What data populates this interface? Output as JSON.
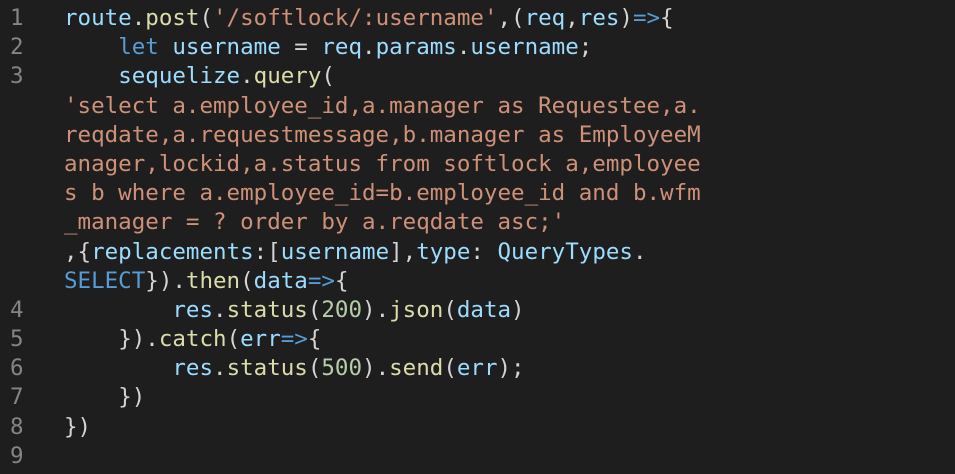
{
  "editor": {
    "colors": {
      "background": "#1e1e1e",
      "line_number": "#858585",
      "plain": "#d4d4d4",
      "function": "#dcdcaa",
      "variable": "#9cdcfe",
      "keyword": "#569cd6",
      "string": "#ce9178",
      "number": "#b5cea8"
    },
    "lines": [
      {
        "num": "1",
        "indent": "",
        "tokens": [
          {
            "t": "route",
            "c": "var"
          },
          {
            "t": ".",
            "c": "plain"
          },
          {
            "t": "post",
            "c": "fn"
          },
          {
            "t": "(",
            "c": "plain"
          },
          {
            "t": "'/softlock/:username'",
            "c": "str"
          },
          {
            "t": ",(",
            "c": "plain"
          },
          {
            "t": "req",
            "c": "var"
          },
          {
            "t": ",",
            "c": "plain"
          },
          {
            "t": "res",
            "c": "var"
          },
          {
            "t": ")",
            "c": "plain"
          },
          {
            "t": "=>",
            "c": "kw"
          },
          {
            "t": "{",
            "c": "plain"
          }
        ]
      },
      {
        "num": "2",
        "indent": "    ",
        "tokens": [
          {
            "t": "let",
            "c": "kw"
          },
          {
            "t": " ",
            "c": "plain"
          },
          {
            "t": "username",
            "c": "var"
          },
          {
            "t": " = ",
            "c": "plain"
          },
          {
            "t": "req",
            "c": "var"
          },
          {
            "t": ".",
            "c": "plain"
          },
          {
            "t": "params",
            "c": "var"
          },
          {
            "t": ".",
            "c": "plain"
          },
          {
            "t": "username",
            "c": "var"
          },
          {
            "t": ";",
            "c": "plain"
          }
        ]
      },
      {
        "num": "3",
        "indent": "    ",
        "tokens": [
          {
            "t": "sequelize",
            "c": "var"
          },
          {
            "t": ".",
            "c": "plain"
          },
          {
            "t": "query",
            "c": "fn"
          },
          {
            "t": "(",
            "c": "plain"
          }
        ]
      },
      {
        "num": "",
        "indent": "",
        "tokens": [
          {
            "t": "'select a.employee_id,a.manager as Requestee,a.",
            "c": "str"
          }
        ]
      },
      {
        "num": "",
        "indent": "",
        "tokens": [
          {
            "t": "reqdate,a.requestmessage,b.manager as EmployeeM",
            "c": "str"
          }
        ]
      },
      {
        "num": "",
        "indent": "",
        "tokens": [
          {
            "t": "anager,lockid,a.status from softlock a,employee",
            "c": "str"
          }
        ]
      },
      {
        "num": "",
        "indent": "",
        "tokens": [
          {
            "t": "s b where a.employee_id=b.employee_id and b.wfm",
            "c": "str"
          }
        ]
      },
      {
        "num": "",
        "indent": "",
        "tokens": [
          {
            "t": "_manager = ? order by a.reqdate asc;'",
            "c": "str"
          }
        ]
      },
      {
        "num": "",
        "indent": "",
        "tokens": [
          {
            "t": ",{",
            "c": "plain"
          },
          {
            "t": "replacements",
            "c": "var"
          },
          {
            "t": ":[",
            "c": "plain"
          },
          {
            "t": "username",
            "c": "var"
          },
          {
            "t": "],",
            "c": "plain"
          },
          {
            "t": "type",
            "c": "var"
          },
          {
            "t": ": ",
            "c": "plain"
          },
          {
            "t": "QueryTypes",
            "c": "var"
          },
          {
            "t": ".",
            "c": "plain"
          }
        ]
      },
      {
        "num": "",
        "indent": "",
        "tokens": [
          {
            "t": "SELECT",
            "c": "kw"
          },
          {
            "t": "}).",
            "c": "plain"
          },
          {
            "t": "then",
            "c": "fn"
          },
          {
            "t": "(",
            "c": "plain"
          },
          {
            "t": "data",
            "c": "var"
          },
          {
            "t": "=>",
            "c": "kw"
          },
          {
            "t": "{",
            "c": "plain"
          }
        ]
      },
      {
        "num": "4",
        "indent": "        ",
        "tokens": [
          {
            "t": "res",
            "c": "var"
          },
          {
            "t": ".",
            "c": "plain"
          },
          {
            "t": "status",
            "c": "fn"
          },
          {
            "t": "(",
            "c": "plain"
          },
          {
            "t": "200",
            "c": "num"
          },
          {
            "t": ").",
            "c": "plain"
          },
          {
            "t": "json",
            "c": "fn"
          },
          {
            "t": "(",
            "c": "plain"
          },
          {
            "t": "data",
            "c": "var"
          },
          {
            "t": ")",
            "c": "plain"
          }
        ]
      },
      {
        "num": "5",
        "indent": "    ",
        "tokens": [
          {
            "t": "}).",
            "c": "plain"
          },
          {
            "t": "catch",
            "c": "fn"
          },
          {
            "t": "(",
            "c": "plain"
          },
          {
            "t": "err",
            "c": "var"
          },
          {
            "t": "=>",
            "c": "kw"
          },
          {
            "t": "{",
            "c": "plain"
          }
        ]
      },
      {
        "num": "6",
        "indent": "        ",
        "tokens": [
          {
            "t": "res",
            "c": "var"
          },
          {
            "t": ".",
            "c": "plain"
          },
          {
            "t": "status",
            "c": "fn"
          },
          {
            "t": "(",
            "c": "plain"
          },
          {
            "t": "500",
            "c": "num"
          },
          {
            "t": ").",
            "c": "plain"
          },
          {
            "t": "send",
            "c": "fn"
          },
          {
            "t": "(",
            "c": "plain"
          },
          {
            "t": "err",
            "c": "var"
          },
          {
            "t": ");",
            "c": "plain"
          }
        ]
      },
      {
        "num": "7",
        "indent": "    ",
        "tokens": [
          {
            "t": "})",
            "c": "plain"
          }
        ]
      },
      {
        "num": "8",
        "indent": "",
        "tokens": [
          {
            "t": "})",
            "c": "plain"
          }
        ]
      },
      {
        "num": "9",
        "indent": "",
        "tokens": []
      }
    ]
  }
}
